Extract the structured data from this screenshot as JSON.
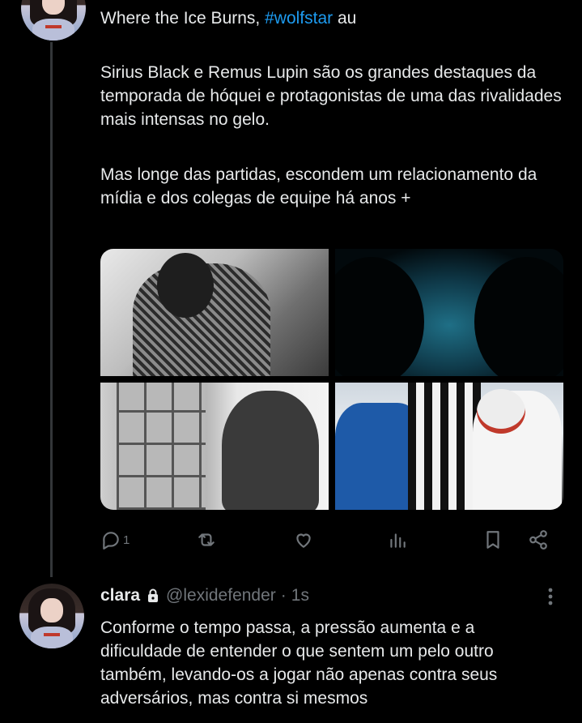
{
  "tweet1": {
    "title_prefix": "Where the Ice Burns, ",
    "hashtag": "#wolfstar",
    "title_suffix": " au",
    "para1": "Sirius Black e Remus Lupin são os grandes destaques da temporada de hóquei e protagonistas de uma das rivalidades mais intensas no gelo.",
    "para2": "Mas longe das partidas, escondem um relacionamento da mídia e dos colegas de equipe há anos +",
    "actions": {
      "reply_count": "1",
      "retweet_count": "",
      "like_count": "",
      "views_count": ""
    }
  },
  "tweet2": {
    "name": "clara",
    "handle": "@lexidefender",
    "separator": "·",
    "time": "1s",
    "text": "Conforme o tempo passa, a pressão aumenta e a dificuldade de entender o que sentem um pelo outro também, levando-os a jogar não apenas contra seus adversários, mas contra si mesmos"
  },
  "colors": {
    "background": "#000000",
    "text": "#e7e9ea",
    "muted": "#71767b",
    "hashtag": "#1d9bf0",
    "thread_line": "#333639"
  },
  "icons": [
    "reply-icon",
    "retweet-icon",
    "like-icon",
    "views-icon",
    "bookmark-icon",
    "share-icon",
    "lock-icon",
    "more-icon"
  ]
}
